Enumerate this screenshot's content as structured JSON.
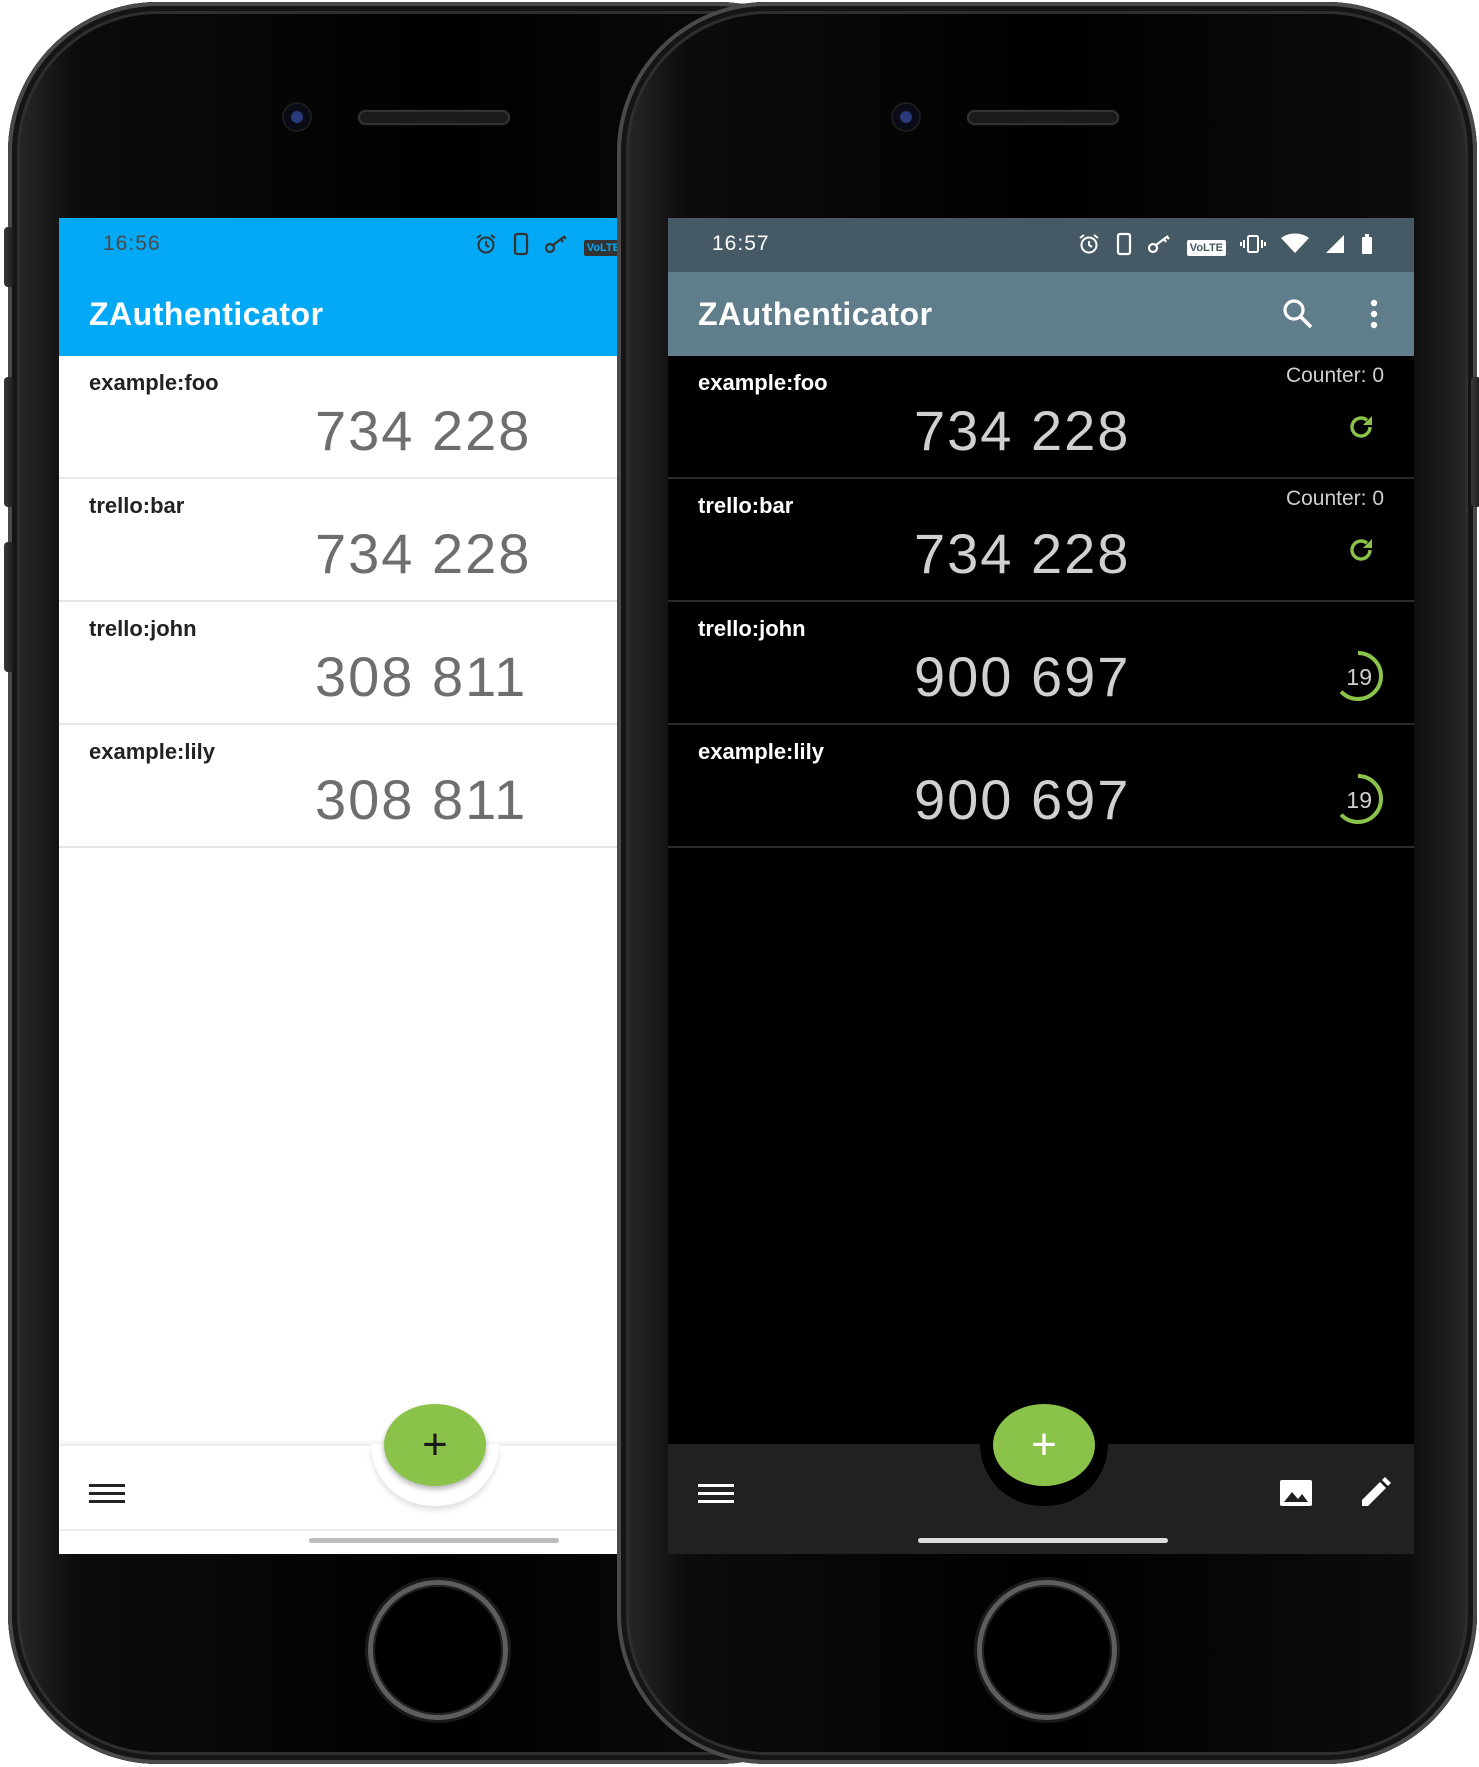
{
  "app": {
    "title": "ZAuthenticator"
  },
  "left_phone": {
    "theme": "light",
    "colors": {
      "statusbar": "#03a9f4",
      "toolbar": "#03a9f4",
      "background": "#ffffff",
      "fab": "#8bc34a"
    },
    "status": {
      "time": "16:56",
      "icons": [
        "alarm-icon",
        "phone-icon",
        "key-icon",
        "volte-icon"
      ],
      "volte_label": "VoLTE"
    },
    "accounts": [
      {
        "name": "example:foo",
        "code": "734 228"
      },
      {
        "name": "trello:bar",
        "code": "734 228"
      },
      {
        "name": "trello:john",
        "code": "308 811"
      },
      {
        "name": "example:lily",
        "code": "308 811"
      }
    ],
    "fab_label": "+"
  },
  "right_phone": {
    "theme": "dark",
    "colors": {
      "statusbar": "#455a64",
      "toolbar": "#607d8b",
      "background": "#000000",
      "accent": "#8bc34a",
      "fab": "#8bc34a"
    },
    "status": {
      "time": "16:57",
      "icons": [
        "alarm-icon",
        "phone-icon",
        "key-icon",
        "volte-icon",
        "vibrate-icon",
        "wifi-icon",
        "signal-icon",
        "battery-icon"
      ],
      "volte_label": "VoLTE"
    },
    "toolbar_icons": [
      "search-icon",
      "more-vert-icon"
    ],
    "accounts": [
      {
        "name": "example:foo",
        "code": "734 228",
        "counter": "Counter: 0",
        "type": "hotp"
      },
      {
        "name": "trello:bar",
        "code": "734 228",
        "counter": "Counter: 0",
        "type": "hotp"
      },
      {
        "name": "trello:john",
        "code": "900 697",
        "timer": "19",
        "timer_fraction": 0.63,
        "type": "totp"
      },
      {
        "name": "example:lily",
        "code": "900 697",
        "timer": "19",
        "timer_fraction": 0.63,
        "type": "totp"
      }
    ],
    "bottom_icons": [
      "menu-icon",
      "image-icon",
      "edit-icon"
    ],
    "fab_label": "+"
  }
}
